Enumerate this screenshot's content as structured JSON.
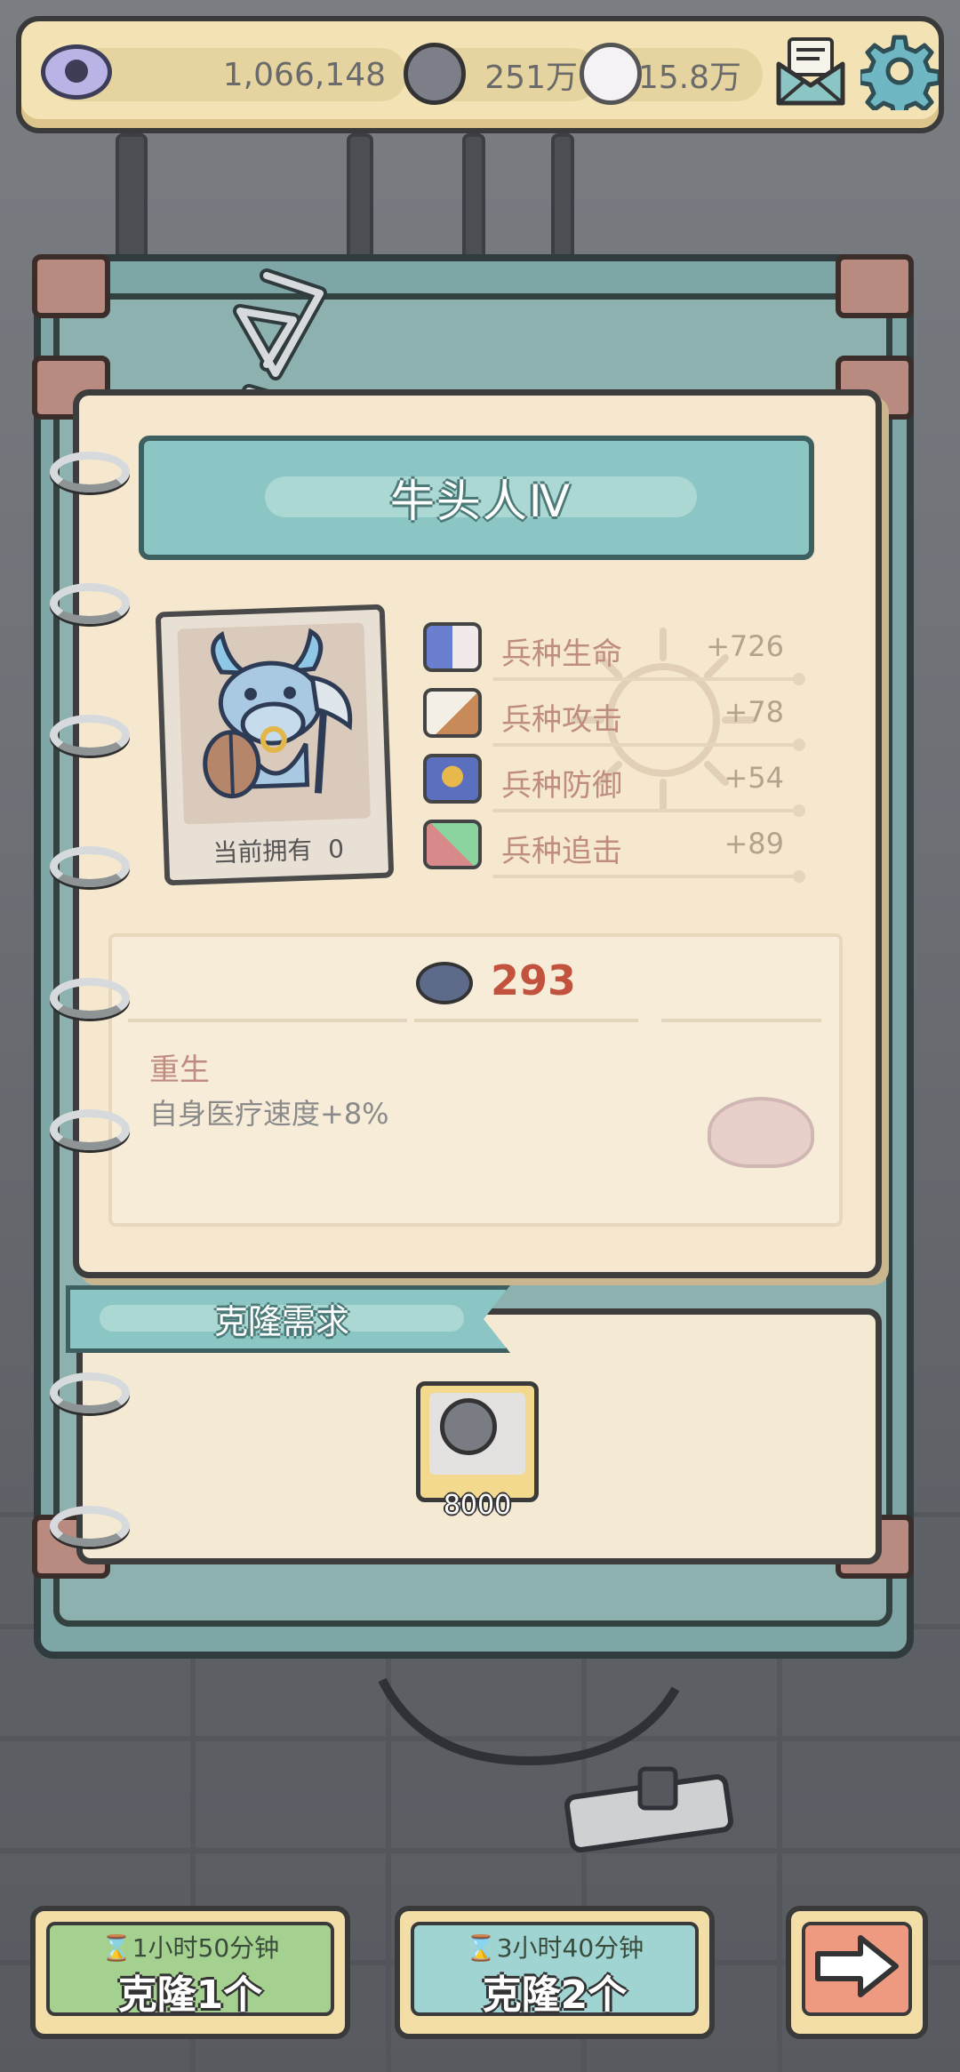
{
  "resources": {
    "eye_count": "1,066,148",
    "soul_count": "251万",
    "ghost_count": "15.8万"
  },
  "icons": {
    "eye": "eye-icon",
    "soul": "soul-icon",
    "ghost": "ghost-icon",
    "mail": "mail-icon",
    "settings": "gear-icon",
    "next": "arrow-right-icon"
  },
  "unit": {
    "name": "牛头人Ⅳ",
    "owned_label": "当前拥有",
    "owned_count": "0"
  },
  "stats": [
    {
      "name": "兵种生命",
      "value": "+726",
      "icon": "health-pill-icon"
    },
    {
      "name": "兵种攻击",
      "value": "+78",
      "icon": "sword-icon"
    },
    {
      "name": "兵种防御",
      "value": "+54",
      "icon": "shield-icon"
    },
    {
      "name": "兵种追击",
      "value": "+89",
      "icon": "pursuit-icon"
    }
  ],
  "skill": {
    "cost": "293",
    "name": "重生",
    "description": "自身医疗速度+8%"
  },
  "clone_requirement": {
    "title": "克隆需求",
    "item_amount": "8000"
  },
  "buttons": {
    "clone_one_time": "1小时50分钟",
    "clone_one_label": "克隆1个",
    "clone_two_time": "3小时40分钟",
    "clone_two_label": "克隆2个"
  },
  "colors": {
    "accent_teal": "#8bc6c4",
    "paper": "#f5e8ce",
    "cost_red": "#c2523e",
    "stat_label": "#bf8c82"
  }
}
